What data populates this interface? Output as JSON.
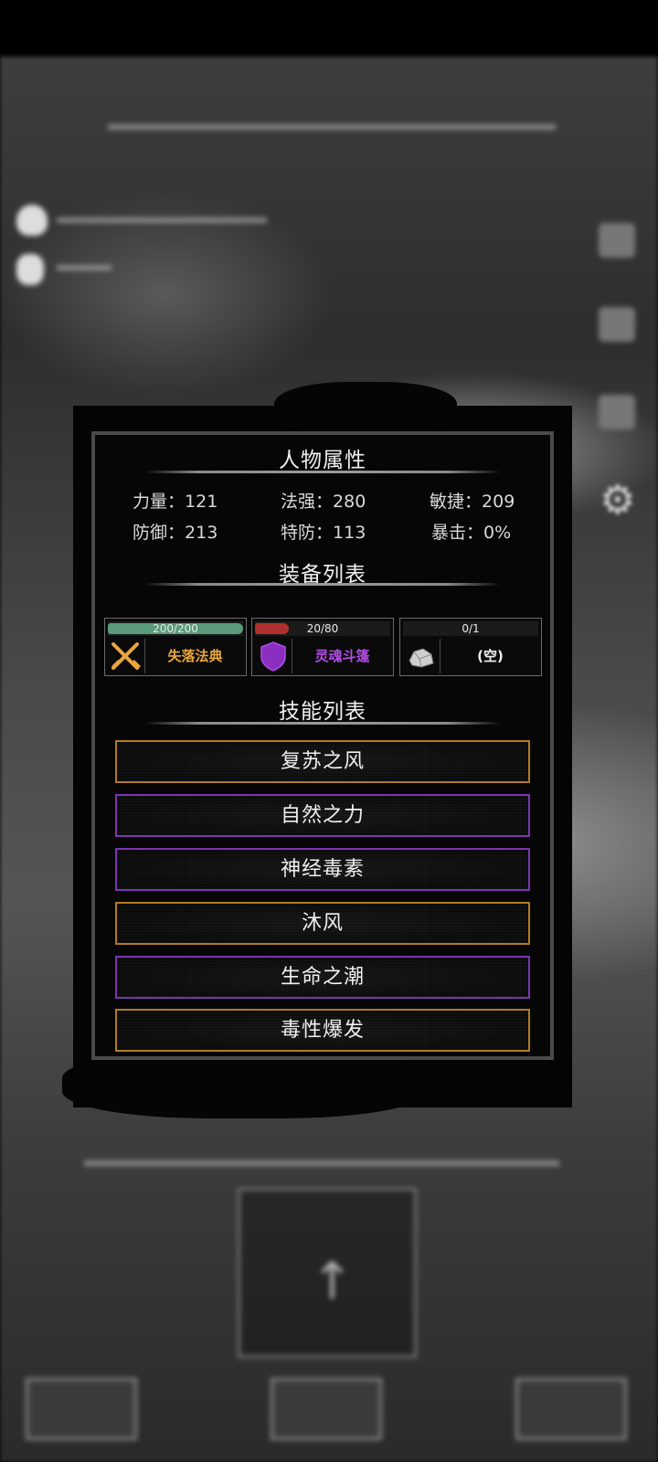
{
  "panel": {
    "attributes_title": "人物属性",
    "stats": [
      {
        "label": "力量：",
        "value": "121"
      },
      {
        "label": "法强：",
        "value": "280"
      },
      {
        "label": "敏捷：",
        "value": "209"
      },
      {
        "label": "防御：",
        "value": "213"
      },
      {
        "label": "特防：",
        "value": "113"
      },
      {
        "label": "暴击：",
        "value": "0%"
      }
    ],
    "equipment_title": "装备列表",
    "equipment": [
      {
        "durability": "200/200",
        "durability_fraction": 1.0,
        "name": "失落法典",
        "name_color": "#e8a63c",
        "bar_color": "#5a9a7a",
        "icon": "crossed-swords-icon"
      },
      {
        "durability": "20/80",
        "durability_fraction": 0.25,
        "name": "灵魂斗篷",
        "name_color": "#b34ce6",
        "bar_color": "#b03030",
        "icon": "purple-shield-icon"
      },
      {
        "durability": "0/1",
        "durability_fraction": 0.0,
        "name": "(空)",
        "name_color": "#f0f0f0",
        "bar_color": "#555555",
        "icon": "rock-icon"
      }
    ],
    "skills_title": "技能列表",
    "skills": [
      {
        "name": "复苏之风",
        "border": "#b07a22"
      },
      {
        "name": "自然之力",
        "border": "#7a35b0"
      },
      {
        "name": "神经毒素",
        "border": "#7a35b0"
      },
      {
        "name": "沐风",
        "border": "#b07a22"
      },
      {
        "name": "生命之潮",
        "border": "#7a35b0"
      },
      {
        "name": "毒性爆发",
        "border": "#b07a22"
      }
    ]
  }
}
